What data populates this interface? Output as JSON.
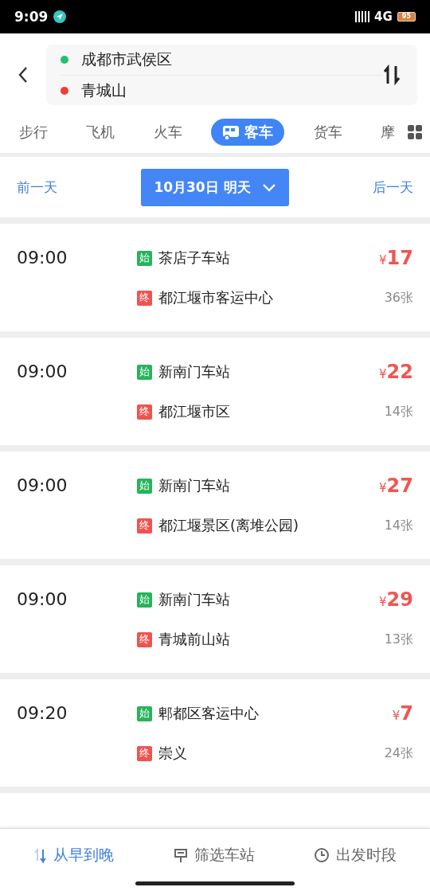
{
  "status_bar": {
    "time": "9:09",
    "network": "4G",
    "battery": "95"
  },
  "route": {
    "origin": "成都市武侯区",
    "destination": "青城山"
  },
  "modes": [
    {
      "label": "步行",
      "selected": false
    },
    {
      "label": "飞机",
      "selected": false
    },
    {
      "label": "火车",
      "selected": false
    },
    {
      "label": "客车",
      "selected": true
    },
    {
      "label": "货车",
      "selected": false
    },
    {
      "label": "摩",
      "selected": false
    }
  ],
  "date_bar": {
    "previous": "前一天",
    "date": "10月30日 明天",
    "next": "后一天"
  },
  "trips": [
    {
      "time": "09:00",
      "stops": [
        {
          "kind": "start",
          "tag": "始",
          "name": "茶店子车站"
        },
        {
          "kind": "end",
          "tag": "终",
          "name": "都江堰市客运中心"
        }
      ],
      "currency": "¥",
      "price": "17",
      "tickets": "36张"
    },
    {
      "time": "09:00",
      "stops": [
        {
          "kind": "start",
          "tag": "始",
          "name": "新南门车站"
        },
        {
          "kind": "end",
          "tag": "终",
          "name": "都江堰市区"
        }
      ],
      "currency": "¥",
      "price": "22",
      "tickets": "14张"
    },
    {
      "time": "09:00",
      "stops": [
        {
          "kind": "start",
          "tag": "始",
          "name": "新南门车站"
        },
        {
          "kind": "end",
          "tag": "终",
          "name": "都江堰景区(离堆公园)"
        }
      ],
      "currency": "¥",
      "price": "27",
      "tickets": "14张"
    },
    {
      "time": "09:00",
      "stops": [
        {
          "kind": "start",
          "tag": "始",
          "name": "新南门车站"
        },
        {
          "kind": "end",
          "tag": "终",
          "name": "青城前山站"
        }
      ],
      "currency": "¥",
      "price": "29",
      "tickets": "13张"
    },
    {
      "time": "09:20",
      "stops": [
        {
          "kind": "start",
          "tag": "始",
          "name": "郫都区客运中心"
        },
        {
          "kind": "end",
          "tag": "终",
          "name": "崇义"
        }
      ],
      "currency": "¥",
      "price": "7",
      "tickets": "24张"
    }
  ],
  "bottom_bar": [
    {
      "kind": "sort",
      "label": "从早到晚",
      "selected": true
    },
    {
      "kind": "filter",
      "label": "筛选车站",
      "selected": false
    },
    {
      "kind": "time",
      "label": "出发时段",
      "selected": false
    }
  ]
}
